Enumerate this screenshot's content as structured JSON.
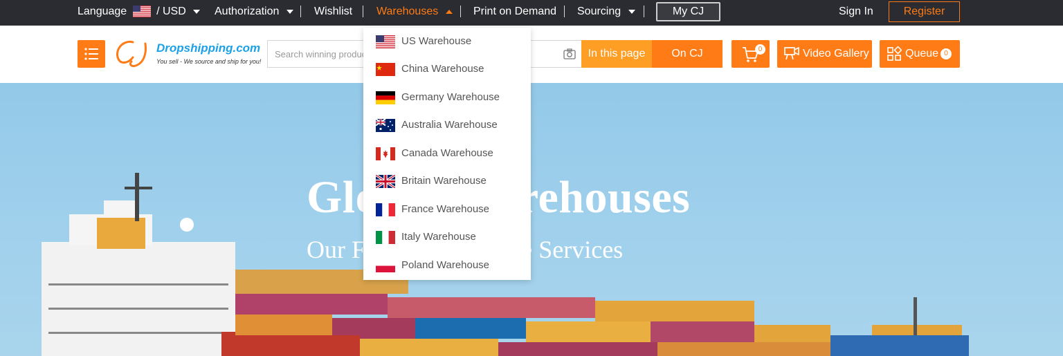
{
  "topbar": {
    "language_label": "Language",
    "currency_label": "/ USD",
    "authorization_label": "Authorization",
    "wishlist_label": "Wishlist",
    "warehouses_label": "Warehouses",
    "print_on_demand_label": "Print on Demand",
    "sourcing_label": "Sourcing",
    "mycj_label": "My CJ",
    "signin_label": "Sign In",
    "register_label": "Register"
  },
  "header": {
    "logo_text_brand": "Dropshipping",
    "logo_text_domain": ".com",
    "logo_tagline": "You sell - We source and ship for you!",
    "search_placeholder": "Search winning products or enter AliExpress URL",
    "in_this_page_label": "In this page",
    "on_cj_label": "On CJ",
    "cart_count": "0",
    "video_gallery_label": "Video Gallery",
    "queue_label": "Queue",
    "queue_count": "0"
  },
  "hero": {
    "title": "Global Warehouses",
    "subtitle": "Our Fast and Effective Services"
  },
  "warehouses_menu": {
    "items": [
      {
        "label": "US Warehouse",
        "flag": "us-flag"
      },
      {
        "label": "China Warehouse",
        "flag": "china-flag"
      },
      {
        "label": "Germany Warehouse",
        "flag": "germany-flag"
      },
      {
        "label": "Australia Warehouse",
        "flag": "australia-flag"
      },
      {
        "label": "Canada Warehouse",
        "flag": "canada-flag"
      },
      {
        "label": "Britain Warehouse",
        "flag": "britain-flag"
      },
      {
        "label": "France Warehouse",
        "flag": "france-flag"
      },
      {
        "label": "Italy Warehouse",
        "flag": "italy-flag"
      },
      {
        "label": "Poland Warehouse",
        "flag": "poland-flag"
      }
    ]
  },
  "colors": {
    "accent": "#ff7b15",
    "topbar_bg": "#2b2c31",
    "hero_sky": "#9fd0ec"
  }
}
